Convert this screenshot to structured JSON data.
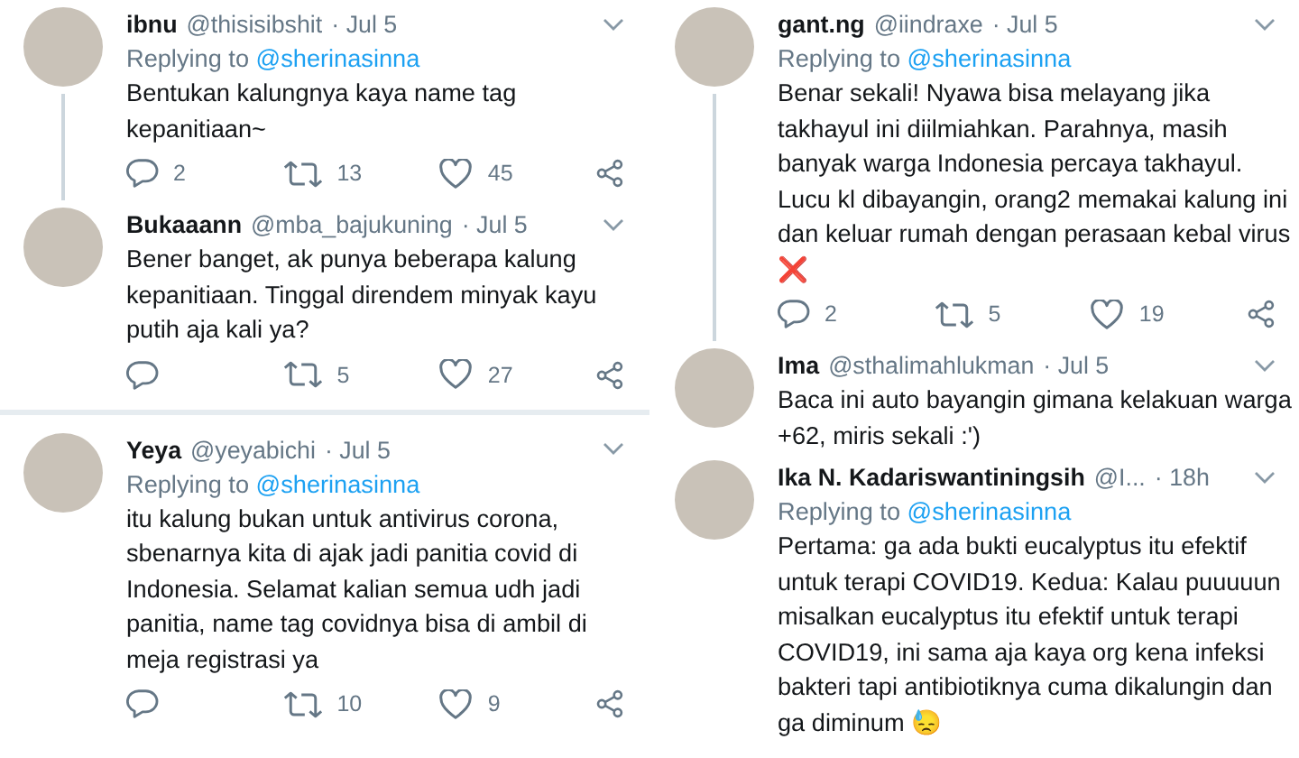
{
  "columns": [
    {
      "tweets": [
        {
          "name": "ibnu",
          "handle": "@thisisibshit",
          "date": "· Jul 5",
          "replying_label": "Replying to",
          "replying_to": "@sherinasinna",
          "text": "Bentukan kalungnya kaya name tag kepanitiaan~",
          "thread_line": true,
          "divider_above": false,
          "stats": {
            "replies": "2",
            "retweets": "13",
            "likes": "45"
          }
        },
        {
          "name": "Bukaaann",
          "handle": "@mba_bajukuning",
          "date": "· Jul 5",
          "text": "Bener banget, ak punya beberapa kalung kepanitiaan. Tinggal direndem minyak kayu putih aja kali ya?",
          "thread_line": false,
          "divider_above": false,
          "stats": {
            "retweets": "5",
            "likes": "27"
          }
        },
        {
          "name": "Yeya",
          "handle": "@yeyabichi",
          "date": "· Jul 5",
          "replying_label": "Replying to",
          "replying_to": "@sherinasinna",
          "text": "itu kalung bukan untuk antivirus corona, sbenarnya kita di ajak jadi panitia covid di Indonesia. Selamat kalian semua udh jadi panitia, name tag covidnya bisa di ambil di meja registrasi ya",
          "thread_line": false,
          "divider_above": true,
          "stats": {
            "retweets": "10",
            "likes": "9"
          }
        }
      ]
    },
    {
      "tweets": [
        {
          "name": "gant.ng",
          "handle": "@iindraxe",
          "date": "· Jul 5",
          "replying_label": "Replying to",
          "replying_to": "@sherinasinna",
          "text": "Benar sekali! Nyawa bisa melayang jika takhayul ini diilmiahkan. Parahnya, masih banyak warga Indonesia percaya takhayul. Lucu kl dibayangin, orang2 memakai kalung ini dan keluar rumah dengan perasaan kebal virus ❌",
          "thread_line": true,
          "divider_above": false,
          "stats": {
            "replies": "2",
            "retweets": "5",
            "likes": "19"
          }
        },
        {
          "name": "Ima",
          "handle": "@sthalimahlukman",
          "date": "· Jul 5",
          "text": "Baca ini auto bayangin gimana kelakuan warga +62, miris sekali :')",
          "thread_line": false,
          "divider_above": false
        },
        {
          "name": "Ika N. Kadariswantiningsih",
          "handle": "@I...",
          "date": "· 18h",
          "replying_label": "Replying to",
          "replying_to": "@sherinasinna",
          "text": "Pertama: ga ada bukti eucalyptus itu efektif untuk terapi COVID19. Kedua: Kalau puuuuun misalkan eucalyptus itu efektif untuk terapi COVID19, ini sama aja kaya org kena infeksi bakteri tapi antibiotiknya cuma dikalungin dan ga diminum 😓",
          "thread_line": false,
          "divider_above": false
        }
      ]
    }
  ]
}
